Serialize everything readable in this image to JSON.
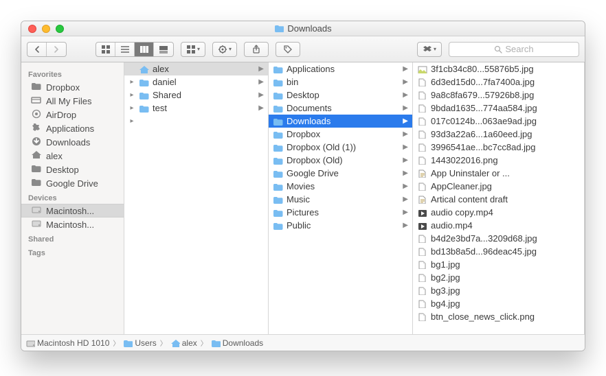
{
  "window": {
    "title": "Downloads"
  },
  "toolbar": {
    "search_placeholder": "Search"
  },
  "sidebar": {
    "sections": [
      {
        "header": "Favorites",
        "items": [
          {
            "label": "Dropbox",
            "icon": "folder"
          },
          {
            "label": "All My Files",
            "icon": "all"
          },
          {
            "label": "AirDrop",
            "icon": "airdrop"
          },
          {
            "label": "Applications",
            "icon": "apps"
          },
          {
            "label": "Downloads",
            "icon": "down"
          },
          {
            "label": "alex",
            "icon": "home"
          },
          {
            "label": "Desktop",
            "icon": "folder"
          },
          {
            "label": "Google Drive",
            "icon": "folder"
          }
        ]
      },
      {
        "header": "Devices",
        "items": [
          {
            "label": "Macintosh...",
            "icon": "hdd",
            "selected": true
          },
          {
            "label": "Macintosh...",
            "icon": "hdd"
          }
        ]
      },
      {
        "header": "Shared",
        "items": []
      },
      {
        "header": "Tags",
        "items": []
      }
    ]
  },
  "columns": [
    {
      "items": [
        {
          "label": "alex",
          "icon": "home",
          "pre": "",
          "folder": true,
          "selected": "gray"
        },
        {
          "label": "daniel",
          "icon": "folder",
          "pre": "▸",
          "folder": true
        },
        {
          "label": "Shared",
          "icon": "folder",
          "pre": "▸",
          "folder": true
        },
        {
          "label": "test",
          "icon": "folder",
          "pre": "▸",
          "folder": true
        },
        {
          "label": "",
          "icon": "",
          "pre": "▸",
          "folder": false
        }
      ]
    },
    {
      "items": [
        {
          "label": "Applications",
          "icon": "folder",
          "folder": true
        },
        {
          "label": "bin",
          "icon": "folder",
          "folder": true
        },
        {
          "label": "Desktop",
          "icon": "folder",
          "folder": true
        },
        {
          "label": "Documents",
          "icon": "folder",
          "folder": true
        },
        {
          "label": "Downloads",
          "icon": "folder",
          "folder": true,
          "selected": "blue"
        },
        {
          "label": "Dropbox",
          "icon": "folder",
          "folder": true
        },
        {
          "label": "Dropbox (Old (1))",
          "icon": "folder",
          "folder": true
        },
        {
          "label": "Dropbox (Old)",
          "icon": "folder",
          "folder": true
        },
        {
          "label": "Google Drive",
          "icon": "folder",
          "folder": true
        },
        {
          "label": "Movies",
          "icon": "folder",
          "folder": true
        },
        {
          "label": "Music",
          "icon": "folder",
          "folder": true
        },
        {
          "label": "Pictures",
          "icon": "folder",
          "folder": true
        },
        {
          "label": "Public",
          "icon": "folder",
          "folder": true
        }
      ]
    },
    {
      "items": [
        {
          "label": "3f1cb34c80...55876b5.jpg",
          "icon": "img"
        },
        {
          "label": "6d3ed15d0...7fa7400a.jpg",
          "icon": "file"
        },
        {
          "label": "9a8c8fa679...57926b8.jpg",
          "icon": "file"
        },
        {
          "label": "9bdad1635...774aa584.jpg",
          "icon": "file"
        },
        {
          "label": "017c0124b...063ae9ad.jpg",
          "icon": "file"
        },
        {
          "label": "93d3a22a6...1a60eed.jpg",
          "icon": "file"
        },
        {
          "label": "3996541ae...bc7cc8ad.jpg",
          "icon": "file"
        },
        {
          "label": "1443022016.png",
          "icon": "file"
        },
        {
          "label": "App Uninstaler or ...",
          "icon": "doc"
        },
        {
          "label": "AppCleaner.jpg",
          "icon": "file"
        },
        {
          "label": "Artical content draft",
          "icon": "doc"
        },
        {
          "label": "audio copy.mp4",
          "icon": "media"
        },
        {
          "label": "audio.mp4",
          "icon": "media"
        },
        {
          "label": "b4d2e3bd7a...3209d68.jpg",
          "icon": "file"
        },
        {
          "label": "bd13b8a5d...96deac45.jpg",
          "icon": "file"
        },
        {
          "label": "bg1.jpg",
          "icon": "file"
        },
        {
          "label": "bg2.jpg",
          "icon": "file"
        },
        {
          "label": "bg3.jpg",
          "icon": "file"
        },
        {
          "label": "bg4.jpg",
          "icon": "file"
        },
        {
          "label": "btn_close_news_click.png",
          "icon": "file"
        }
      ]
    }
  ],
  "pathbar": {
    "crumbs": [
      {
        "label": "Macintosh HD 1010",
        "icon": "hdd"
      },
      {
        "label": "Users",
        "icon": "folder"
      },
      {
        "label": "alex",
        "icon": "home"
      },
      {
        "label": "Downloads",
        "icon": "folder"
      }
    ]
  }
}
